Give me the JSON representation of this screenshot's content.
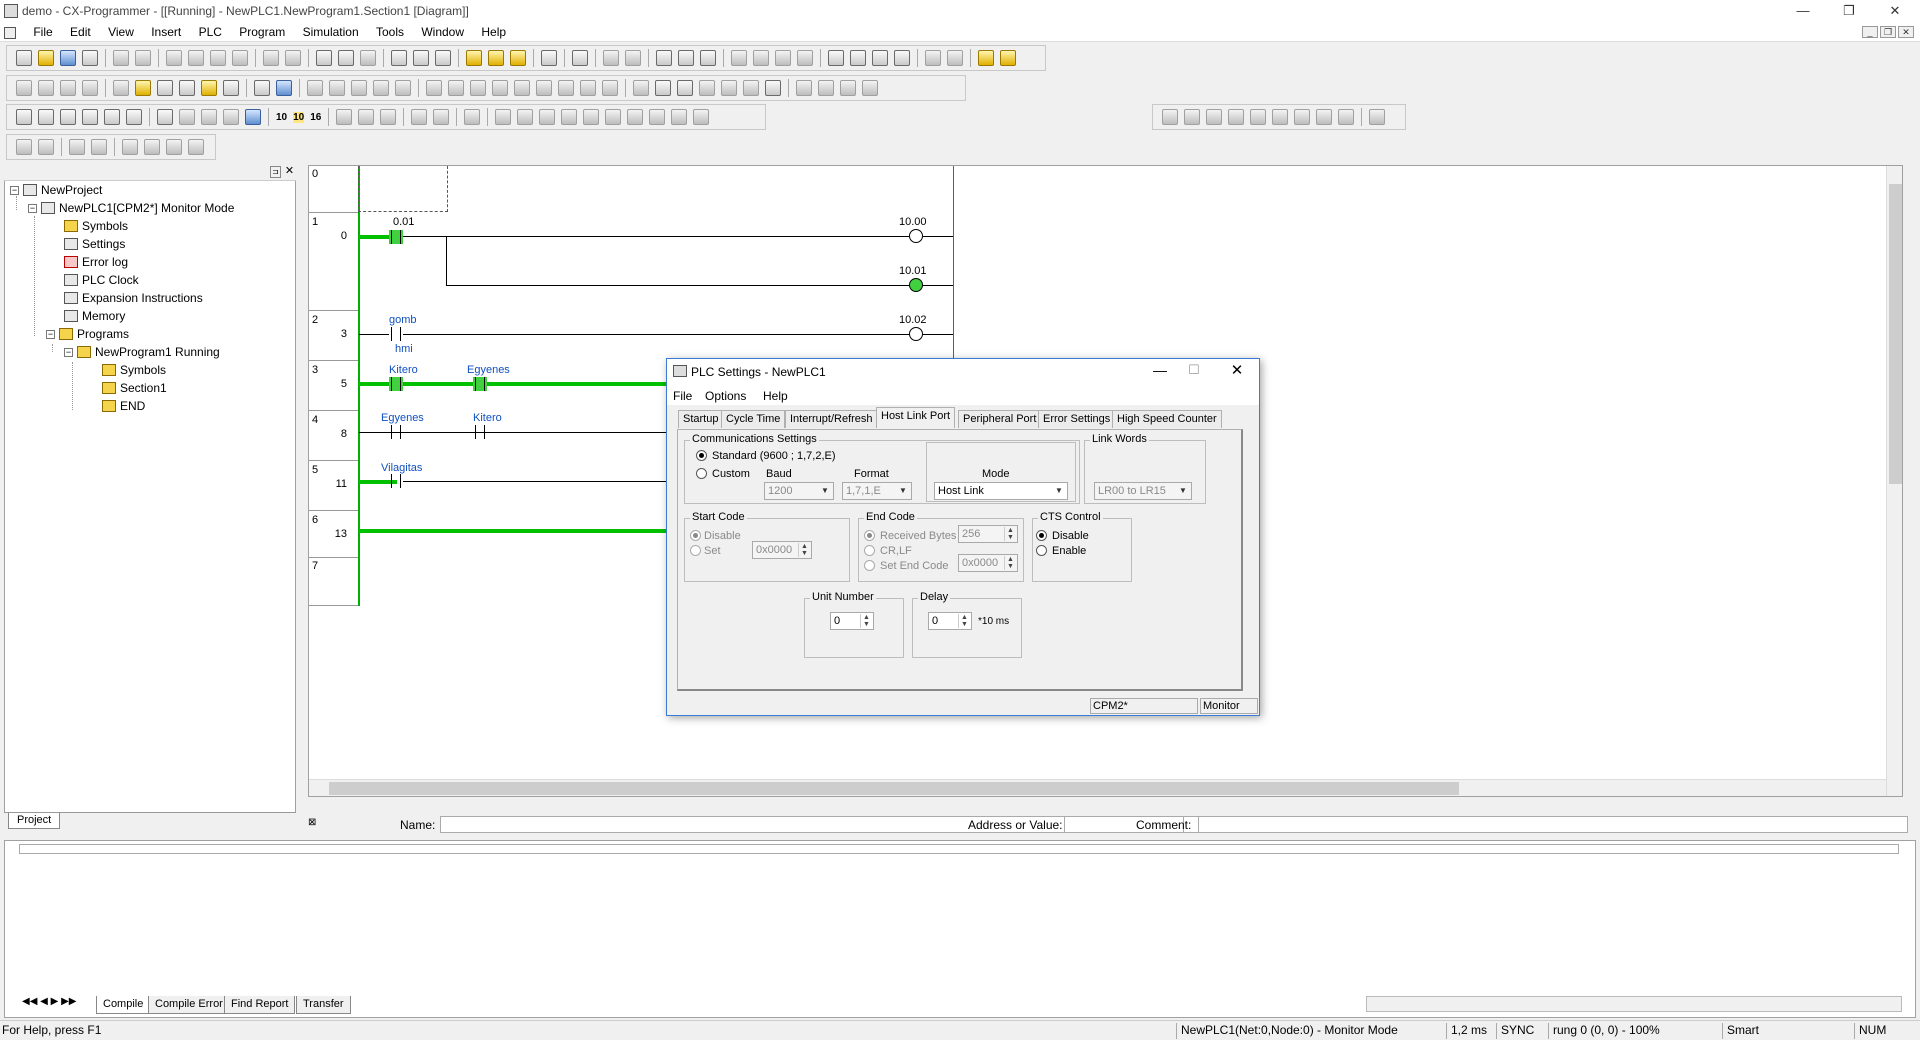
{
  "window": {
    "title": "demo - CX-Programmer - [[Running] - NewPLC1.NewProgram1.Section1 [Diagram]]",
    "minimize": "—",
    "restore": "❐",
    "close": "✕"
  },
  "menu": [
    "File",
    "Edit",
    "View",
    "Insert",
    "PLC",
    "Program",
    "Simulation",
    "Tools",
    "Window",
    "Help"
  ],
  "toolbar3_texts": [
    "10",
    "10",
    "16"
  ],
  "project_tree": {
    "root": "NewProject",
    "plc": "NewPLC1[CPM2*] Monitor Mode",
    "plc_children": [
      "Symbols",
      "Settings",
      "Error log",
      "PLC Clock",
      "Expansion Instructions",
      "Memory"
    ],
    "programs": "Programs",
    "program": "NewProgram1 Running",
    "program_children": [
      "Symbols",
      "Section1",
      "END"
    ],
    "tab": "Project"
  },
  "diagram": {
    "rung_numbers": [
      "0",
      "1",
      "2",
      "3",
      "4",
      "5",
      "6",
      "7"
    ],
    "step_numbers": [
      "0",
      "3",
      "5",
      "8",
      "11",
      "13"
    ],
    "labels": {
      "c001": "0.01",
      "out1000": "10.00",
      "out1001": "10.01",
      "c_gomb": "gomb",
      "c_gomb_sub": "hmi",
      "out1002": "10.02",
      "c_kitero1": "Kitero",
      "c_egyenes1": "Egyenes",
      "c_egyenes2": "Egyenes",
      "c_kitero2": "Kitero",
      "c_vilagitas": "Vilagitas"
    }
  },
  "namebar": {
    "name_label": "Name:",
    "address_label": "Address or Value:",
    "comment_label": "Comment:"
  },
  "dialog": {
    "title": "PLC Settings - NewPLC1",
    "menu": [
      "File",
      "Options",
      "Help"
    ],
    "tabs": [
      "Startup",
      "Cycle Time",
      "Interrupt/Refresh",
      "Host Link Port",
      "Peripheral Port",
      "Error Settings",
      "High Speed Counter"
    ],
    "active_tab": "Host Link Port",
    "comm": {
      "group": "Communications Settings",
      "standard": "Standard (9600 ; 1,7,2,E)",
      "custom": "Custom",
      "baud_label": "Baud",
      "baud_value": "1200",
      "format_label": "Format",
      "format_value": "1,7,1,E",
      "mode_label": "Mode",
      "mode_value": "Host Link"
    },
    "link_words": {
      "group": "Link Words",
      "value": "LR00 to LR15"
    },
    "start_code": {
      "group": "Start Code",
      "disable": "Disable",
      "set": "Set",
      "value": "0x0000"
    },
    "end_code": {
      "group": "End Code",
      "received_bytes": "Received Bytes",
      "received_value": "256",
      "crlf": "CR,LF",
      "set_end_code": "Set End Code",
      "end_value": "0x0000"
    },
    "cts": {
      "group": "CTS Control",
      "disable": "Disable",
      "enable": "Enable"
    },
    "unit_number": {
      "group": "Unit Number",
      "value": "0"
    },
    "delay": {
      "group": "Delay",
      "value": "0",
      "unit": "*10 ms"
    },
    "status": {
      "model": "CPM2*",
      "mode": "Monitor"
    }
  },
  "output_tabs": [
    "Compile",
    "Compile Error",
    "Find Report",
    "Transfer"
  ],
  "statusbar": {
    "help": "For Help, press F1",
    "plc": "NewPLC1(Net:0,Node:0) - Monitor Mode",
    "cycle": "1,2 ms",
    "sync": "SYNC",
    "rung": "rung 0 (0, 0)  - 100%",
    "smart": "Smart",
    "num": "NUM"
  }
}
